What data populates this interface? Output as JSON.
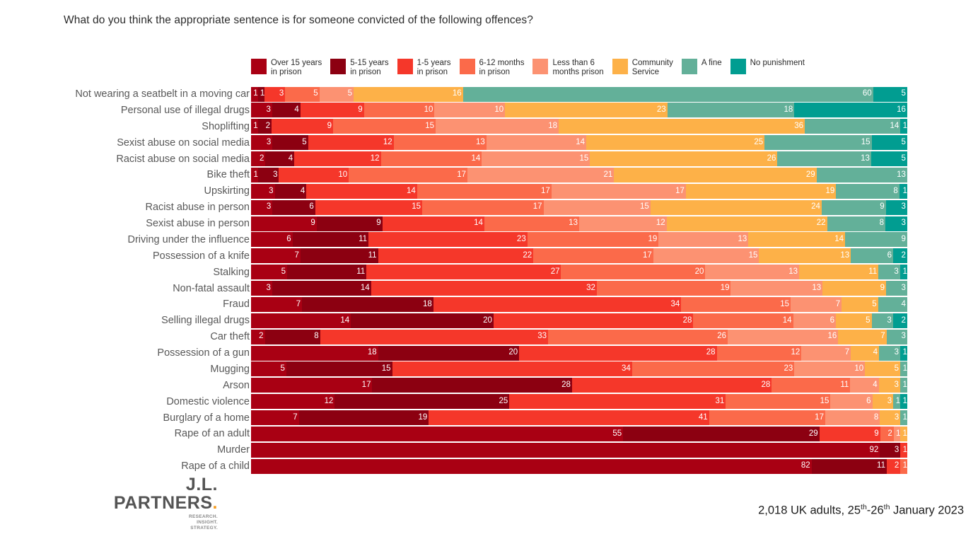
{
  "title": "What do you think the appropriate sentence is for someone convicted of the following offences?",
  "source_note": {
    "sample": "2,018 UK adults, 25",
    "sup1": "th",
    "mid": "-26",
    "sup2": "th",
    "tail": " January 2023"
  },
  "logo": {
    "line1": "J.L.",
    "line2": "PARTNERS",
    "dot": ".",
    "tagline": "RESEARCH.\nINSIGHT.\nSTRATEGY."
  },
  "legend": {
    "position": "top",
    "items": [
      {
        "label": "Over 15 years\nin prison",
        "color": "#a90013"
      },
      {
        "label": "5-15 years\nin prison",
        "color": "#8c0011"
      },
      {
        "label": "1-5 years\nin prison",
        "color": "#f5372a"
      },
      {
        "label": "6-12 months\nin prison",
        "color": "#fb6a4a"
      },
      {
        "label": "Less than 6\nmonths prison",
        "color": "#fc9272"
      },
      {
        "label": "Community\nService",
        "color": "#fdb148"
      },
      {
        "label": "A fine",
        "color": "#63b099"
      },
      {
        "label": "No punishment",
        "color": "#019d91"
      }
    ]
  },
  "chart_data": {
    "type": "bar",
    "orientation": "horizontal",
    "stacked": true,
    "normalized": true,
    "title": "What do you think the appropriate sentence is for someone convicted of the following offences?",
    "xlabel": "",
    "ylabel": "",
    "xlim": [
      0,
      100
    ],
    "grid": false,
    "legend_position": "top",
    "series": [
      {
        "name": "Over 15 years in prison",
        "color": "#a90013"
      },
      {
        "name": "5-15 years in prison",
        "color": "#8c0011"
      },
      {
        "name": "1-5 years in prison",
        "color": "#f5372a"
      },
      {
        "name": "6-12 months in prison",
        "color": "#fb6a4a"
      },
      {
        "name": "Less than 6 months prison",
        "color": "#fc9272"
      },
      {
        "name": "Community Service",
        "color": "#fdb148"
      },
      {
        "name": "A fine",
        "color": "#63b099"
      },
      {
        "name": "No punishment",
        "color": "#019d91"
      }
    ],
    "categories": [
      "Not wearing a seatbelt in a moving car",
      "Personal use of illegal drugs",
      "Shoplifting",
      "Sexist abuse on social media",
      "Racist abuse on social media",
      "Bike theft",
      "Upskirting",
      "Racist abuse in person",
      "Sexist abuse in person",
      "Driving under the influence",
      "Possession of a knife",
      "Stalking",
      "Non-fatal assault",
      "Fraud",
      "Selling illegal drugs",
      "Car theft",
      "Possession of a gun",
      "Mugging",
      "Arson",
      "Domestic violence",
      "Burglary of a home",
      "Rape of an adult",
      "Murder",
      "Rape of a child"
    ],
    "rows": [
      {
        "label": "Not wearing a seatbelt in a moving car",
        "values": [
          1,
          1,
          3,
          5,
          5,
          16,
          60,
          5
        ]
      },
      {
        "label": "Personal use of illegal drugs",
        "values": [
          3,
          4,
          9,
          10,
          10,
          23,
          18,
          16
        ]
      },
      {
        "label": "Shoplifting",
        "values": [
          1,
          2,
          9,
          15,
          18,
          36,
          14,
          1
        ]
      },
      {
        "label": "Sexist abuse on social media",
        "values": [
          3,
          5,
          12,
          13,
          14,
          25,
          15,
          5
        ]
      },
      {
        "label": "Racist abuse on social media",
        "values": [
          2,
          4,
          12,
          14,
          15,
          26,
          13,
          5
        ]
      },
      {
        "label": "Bike theft",
        "values": [
          1,
          3,
          10,
          17,
          21,
          29,
          13,
          0
        ]
      },
      {
        "label": "Upskirting",
        "values": [
          3,
          4,
          14,
          17,
          17,
          19,
          8,
          1
        ]
      },
      {
        "label": "Racist abuse in person",
        "values": [
          3,
          6,
          15,
          17,
          15,
          24,
          9,
          3
        ]
      },
      {
        "label": "Sexist abuse in person",
        "values": [
          9,
          9,
          14,
          13,
          12,
          22,
          8,
          3
        ]
      },
      {
        "label": "Driving under the influence",
        "values": [
          6,
          11,
          23,
          19,
          13,
          14,
          9,
          0
        ]
      },
      {
        "label": "Possession of a knife",
        "values": [
          7,
          11,
          22,
          17,
          15,
          13,
          6,
          2
        ]
      },
      {
        "label": "Stalking",
        "values": [
          5,
          11,
          27,
          20,
          13,
          11,
          3,
          1
        ]
      },
      {
        "label": "Non-fatal assault",
        "values": [
          3,
          14,
          32,
          19,
          13,
          9,
          3,
          0
        ]
      },
      {
        "label": "Fraud",
        "values": [
          7,
          18,
          34,
          15,
          7,
          5,
          4,
          0
        ]
      },
      {
        "label": "Selling illegal drugs",
        "values": [
          14,
          20,
          28,
          14,
          6,
          5,
          3,
          2
        ]
      },
      {
        "label": "Car theft",
        "values": [
          2,
          8,
          33,
          26,
          16,
          7,
          3,
          0
        ]
      },
      {
        "label": "Possession of a gun",
        "values": [
          18,
          20,
          28,
          12,
          7,
          4,
          3,
          1
        ]
      },
      {
        "label": "Mugging",
        "values": [
          5,
          15,
          34,
          23,
          10,
          5,
          1,
          0
        ]
      },
      {
        "label": "Arson",
        "values": [
          17,
          28,
          28,
          11,
          4,
          3,
          1,
          0
        ]
      },
      {
        "label": "Domestic violence",
        "values": [
          12,
          25,
          31,
          15,
          6,
          3,
          1,
          1
        ]
      },
      {
        "label": "Burglary of a home",
        "values": [
          7,
          19,
          41,
          17,
          8,
          3,
          1,
          0
        ]
      },
      {
        "label": "Rape of an adult",
        "values": [
          55,
          29,
          9,
          2,
          1,
          1,
          0,
          0
        ]
      },
      {
        "label": "Murder",
        "values": [
          92,
          3,
          1,
          0,
          0,
          0,
          0,
          0
        ]
      },
      {
        "label": "Rape of a child",
        "values": [
          82,
          11,
          2,
          1,
          0,
          0,
          0,
          0
        ]
      }
    ]
  }
}
